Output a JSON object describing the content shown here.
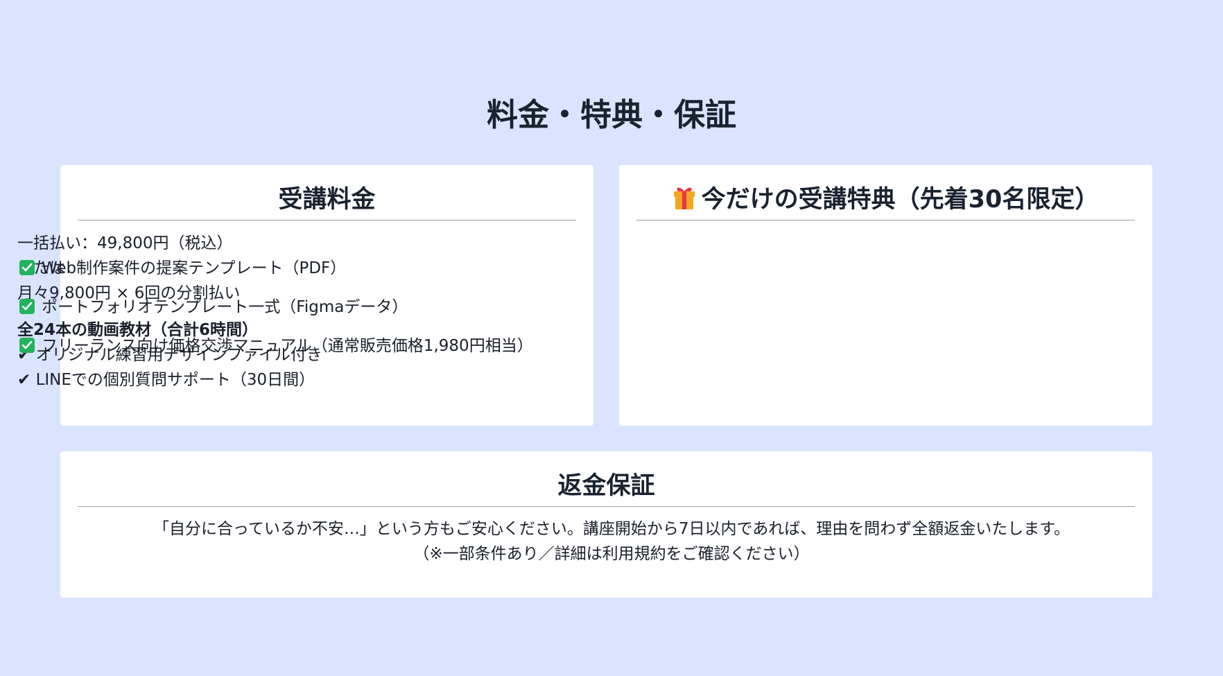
{
  "page": {
    "title": "料金・特典・保証"
  },
  "price": {
    "heading": "受講料金",
    "lines": [
      "一括払い：49,800円（税込）",
      "または",
      "月々9,800円 × 6回の分割払い"
    ],
    "features_title": "全24本の動画教材（合計6時間）",
    "features": [
      "✔ オリジナル練習用デザインファイル付き",
      "✔ LINEでの個別質問サポート（30日間）"
    ]
  },
  "bonus": {
    "heading": "今だけの受講特典（先着30名限定）",
    "icon": "gift-icon",
    "check_icon": "check-box-icon",
    "accent_color": "#22b35e",
    "items": [
      "Web制作案件の提案テンプレート（PDF）",
      "ポートフォリオテンプレート一式（Figmaデータ）",
      "フリーランス向け価格交渉マニュアル（通常販売価格1,980円相当）"
    ]
  },
  "refund": {
    "heading": "返金保証",
    "text": "「自分に合っているか不安…」という方もご安心ください。講座開始から7日以内であれば、理由を問わず全額返金いたします。",
    "note": "（※一部条件あり／詳細は利用規約をご確認ください）"
  },
  "colors": {
    "background": "#dbe4ff",
    "card": "#ffffff",
    "text": "#1a2230"
  }
}
